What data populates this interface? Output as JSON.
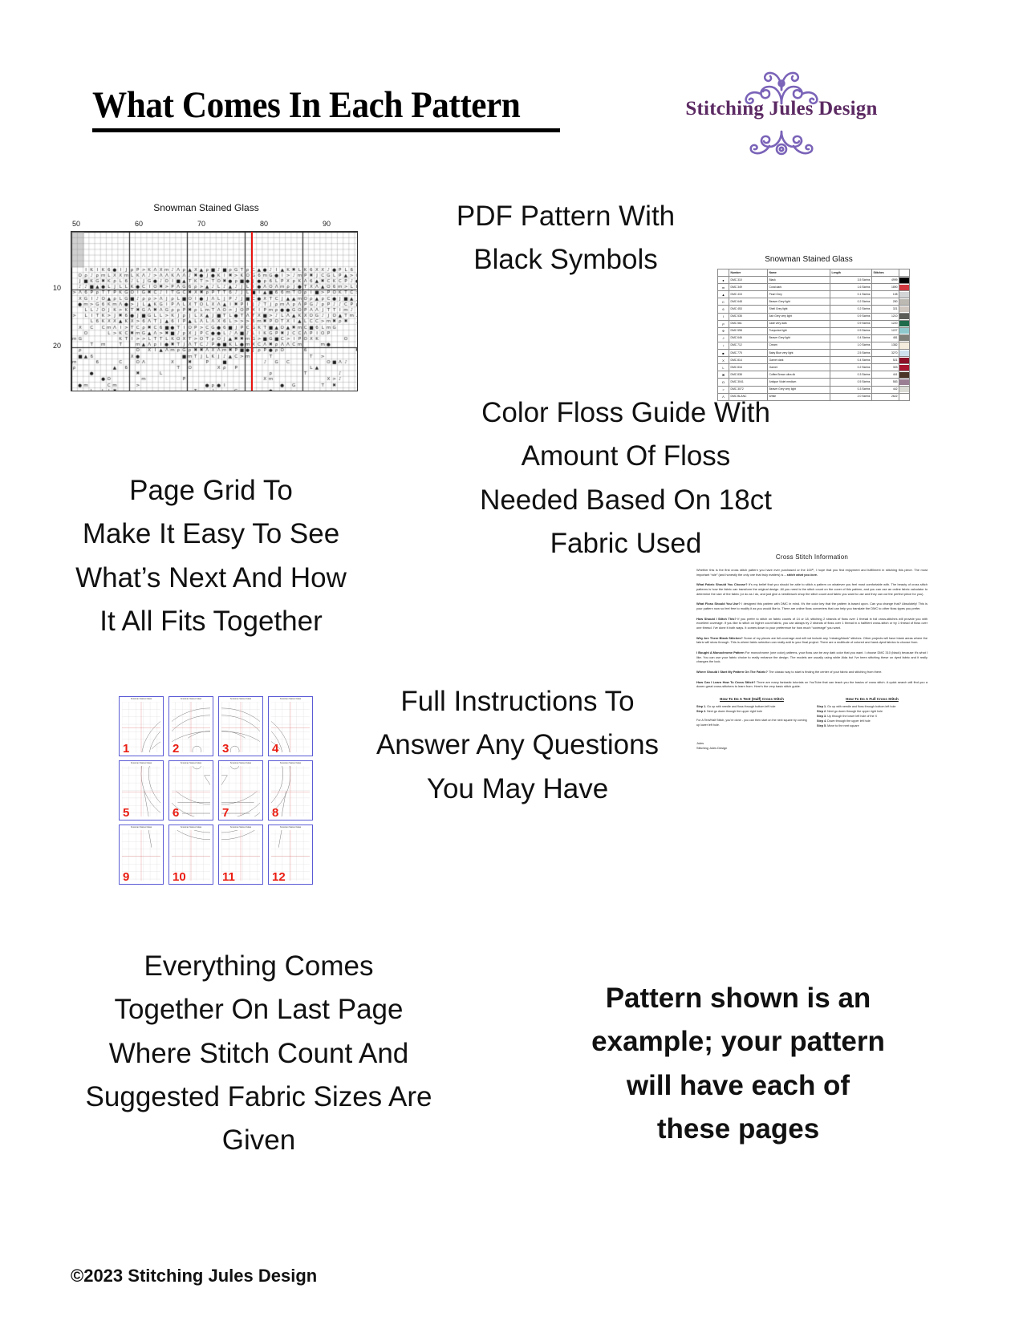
{
  "header": {
    "title": "What Comes In Each Pattern",
    "logo_text": "Stitching Jules Design",
    "logo_color": "#5c2a63",
    "flourish_color": "#7a63b8"
  },
  "captions": {
    "pdf_pattern": "PDF Pattern With\nBlack Symbols",
    "page_grid": "Page Grid To\nMake It Easy To See\nWhat’s Next And How\nIt All Fits Together",
    "floss_guide": "Color Floss Guide With\nAmount Of Floss\nNeeded Based On 18ct\nFabric Used",
    "instructions": "Full Instructions To\nAnswer Any Questions\nYou May Have",
    "last_page": "Everything Comes\nTogether On Last Page\nWhere Stitch Count And\nSuggested Fabric Sizes Are\nGiven",
    "disclaimer": "Pattern shown is an\nexample; your pattern\nwill have each of\nthese pages"
  },
  "chart": {
    "title": "Snowman Stained Glass",
    "column_labels": [
      "50",
      "60",
      "70",
      "80",
      "90"
    ],
    "row_labels": [
      "10",
      "20"
    ],
    "center_line_color": "#e8140f"
  },
  "floss_table": {
    "title": "Snowman Stained Glass",
    "columns": [
      "",
      "Number",
      "Name",
      "Length",
      "Stitches",
      ""
    ],
    "rows": [
      {
        "symbol": "●",
        "number": "DMC   310",
        "name": "Black",
        "length": "3.5 Skeins",
        "stitches": "4999",
        "color": "#000000"
      },
      {
        "symbol": "m",
        "number": "DMC   349",
        "name": "Coral dark",
        "length": "1.6 Skeins",
        "stitches": "1890",
        "color": "#d0373e"
      },
      {
        "symbol": "▲",
        "number": "DMC   415",
        "name": "Pearl Grey",
        "length": "0.1 Skeins",
        "stitches": "108",
        "color": "#d2d4d6"
      },
      {
        "symbol": "C",
        "number": "DMC   648",
        "name": "Beaver Grey light",
        "length": "0.2 Skeins",
        "stitches": "250",
        "color": "#bcb8b2"
      },
      {
        "symbol": "6",
        "number": "DMC   453",
        "name": "Shell Grey light",
        "length": "0.2 Skeins",
        "stitches": "321",
        "color": "#cfc6c0"
      },
      {
        "symbol": "I",
        "number": "DMC   535",
        "name": "Ash Grey very light",
        "length": "0.9 Skeins",
        "stitches": "1210",
        "color": "#5c5c58"
      },
      {
        "symbol": "ρ",
        "number": "DMC   561",
        "name": "Jade very dark",
        "length": "0.9 Skeins",
        "stitches": "1220",
        "color": "#1d6b4b"
      },
      {
        "symbol": "Φ",
        "number": "DMC   598",
        "name": "Turquoise light",
        "length": "0.9 Skeins",
        "stitches": "1227",
        "color": "#8fc9cd"
      },
      {
        "symbol": "J",
        "number": "DMC   646",
        "name": "Beaver Grey light",
        "length": "0.4 Skeins",
        "stitches": "481",
        "color": "#80807a"
      },
      {
        "symbol": "♪",
        "number": "DMC   712",
        "name": "Cream",
        "length": "1.0 Skeins",
        "stitches": "1382",
        "color": "#f4ecdc"
      },
      {
        "symbol": "■",
        "number": "DMC   775",
        "name": "Baby Blue very light",
        "length": "2.5 Skeins",
        "stitches": "3270",
        "color": "#cfe2ee"
      },
      {
        "symbol": "X",
        "number": "DMC   814",
        "name": "Garnet dark",
        "length": "0.4 Skeins",
        "stitches": "521",
        "color": "#8c1028"
      },
      {
        "symbol": "L",
        "number": "DMC   816",
        "name": "Garnet",
        "length": "0.2 Skeins",
        "stitches": "303",
        "color": "#a8152f"
      },
      {
        "symbol": "✖",
        "number": "DMC   838",
        "name": "Coffee Brown ultra dk",
        "length": "0.3 Skeins",
        "stitches": "441",
        "color": "#4a3527"
      },
      {
        "symbol": "Ω",
        "number": "DMC   3041",
        "name": "Antique Violet medium",
        "length": "0.5 Skeins",
        "stitches": "583",
        "color": "#9a7f94"
      },
      {
        "symbol": ">",
        "number": "DMC   3072",
        "name": "Beaver Grey very light",
        "length": "0.3 Skeins",
        "stitches": "442",
        "color": "#dcdcd6"
      },
      {
        "symbol": "Λ",
        "number": "DMC   BLANC",
        "name": "White",
        "length": "2.0 Skeins",
        "stitches": "2622",
        "color": "#ffffff"
      }
    ]
  },
  "page_grid": {
    "thumb_title": "Snowman Stained Glass",
    "numbers": [
      "1",
      "2",
      "3",
      "4",
      "5",
      "6",
      "7",
      "8",
      "9",
      "10",
      "11",
      "12"
    ],
    "border_color": "#5b5bd6",
    "number_color": "#ea1d12"
  },
  "instructions_sheet": {
    "title": "Cross Stitch Information",
    "intro": "Whether this is the first cross stitch pattern you have ever purchased or the 100ᵗʰ, I hope that you find enjoyment and fulfillment in stitching this piece. The most important “rule” (and honestly the only one that truly matters) is – ",
    "intro_em": "stitch what you love.",
    "sections": [
      {
        "heading": "What Fabric Should You Choose?",
        "body": " It’s my belief that you should be able to stitch a pattern on whatever you feel most comfortable with. The beauty of cross stitch patterns is how the fabric can transform the original design.  All you need is the stitch count on the cover of this pattern, and you can use an online fabric calculator to determine the size of the fabric (or do as I do, and just give a needlework shop the stitch count and fabric you want to use and they can cut the perfect piece for you)."
      },
      {
        "heading": "What Floss Should You Use?",
        "body": " I designed this pattern with DMC in mind. It’s the color key that the pattern is based upon. Can you change that? Absolutely! This is your pattern now so feel free to modify it as you would like to.  There are online floss converters that can help you translate the DMC to other floss types you prefer."
      },
      {
        "heading": "How Should I Stitch This?",
        "body": " If you prefer to stitch on fabric counts of 14 or 18, stitching 2 strands of floss over 1 thread in full cross-stitches will provide you with excellent coverage. If you like to stitch on higher count fabric, you can always try 2 strands of floss over 1 thread in a half/tent cross-stitch or try 1 thread of floss over one thread. I’ve done it both ways. It comes down to your preference for how much “coverage” you want."
      },
      {
        "heading": "Why Are There Blank Stitches?",
        "body": " Some of my pieces are full-coverage and will not include any “missing/blank” stitches. Other projects will have blank areas where the fabric will show through. This is where fabric selection can really add to your final project. There are a multitude of colored and hand-dyed fabrics to choose from."
      },
      {
        "heading": "I Bought A Monochrome Pattern",
        "body": " For monochrome (one color) patterns, your floss can be any dark color that you want. I choose DMC 310 (black) because it’s what I like. You can use your fabric choice to really enhance the design. The models are usually using white Aida but I’ve been stitching these on dyed fabric and it really changes the look."
      },
      {
        "heading": "Where Should I Start My Pattern On The Fabric?",
        "body": " The classic way to start is finding the center of your fabric and stitching from there."
      },
      {
        "heading": "How Can I Learn How To Cross Stitch?",
        "body": " There are many fantastic tutorials on YouTube that can teach you the basics of cross stitch. A quick search will find you a dozen great cross-stitchers to learn from. Here’s the very basic stitch guide."
      }
    ],
    "guide_left": {
      "heading": "How To Do A Tent (Half) Cross Stitch",
      "steps": [
        "Step 1. Go up with needle and floss through bottom left hole",
        "Step 2. Next go down through the upper right hole"
      ],
      "note": "For A Tent/Half Stitch, you’re done - you can then start on the next square by coming up lower left hole."
    },
    "guide_right": {
      "heading": "How To Do A Full Cross Stitch",
      "steps": [
        "Step 1. Go up with needle and floss through bottom left hole",
        "Step 2. Next go down through the upper right hole",
        "Step 3. Up through the lower left hole of the X",
        "Step 4. Down through the upper left hole",
        "Step 5. Move to the next square"
      ]
    },
    "signature": "Jules",
    "signature_company": "Stitching Jules Design"
  },
  "footer": {
    "copyright": "©2023 Stitching Jules Design"
  }
}
